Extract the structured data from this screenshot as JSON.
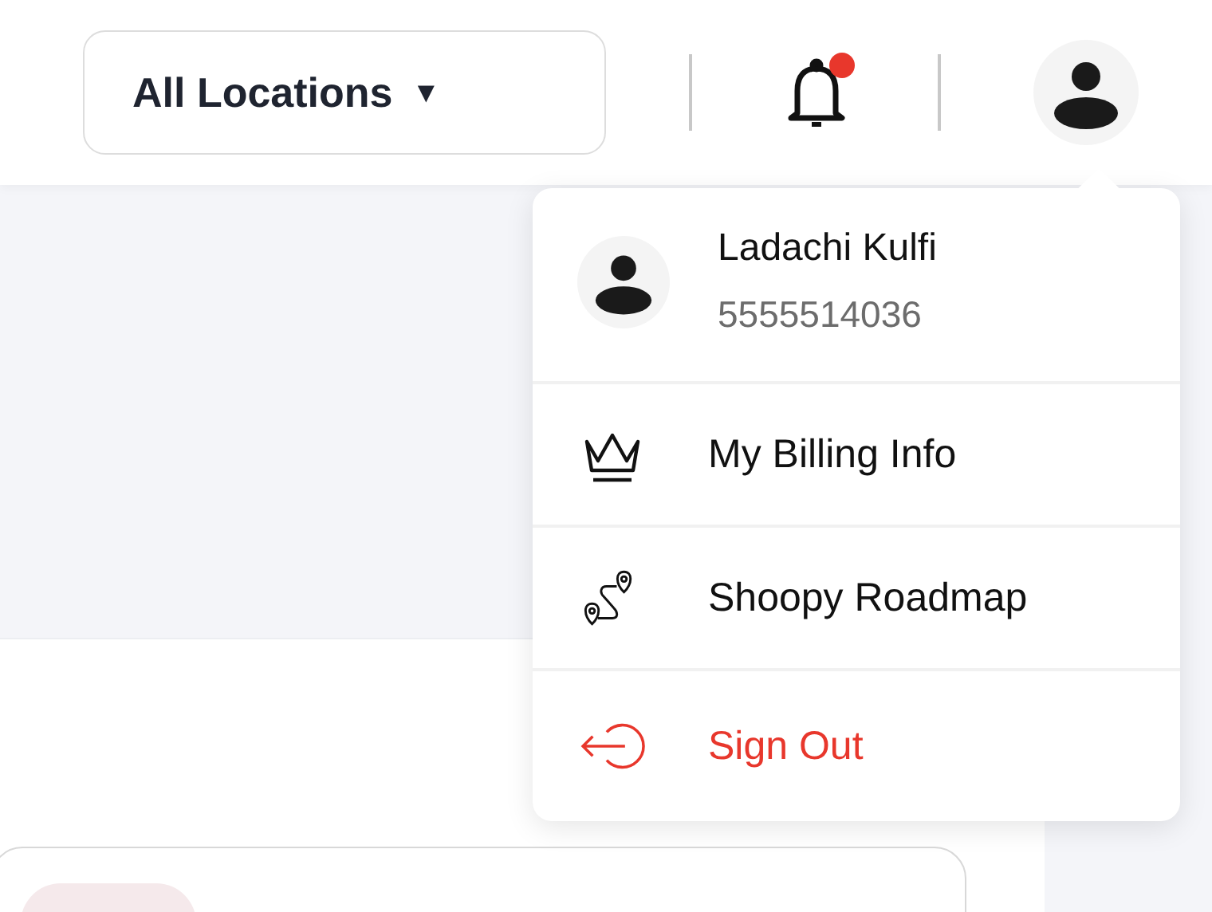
{
  "header": {
    "location_selector": {
      "label": "All Locations",
      "caret": "▼"
    },
    "notifications": {
      "unread": true
    }
  },
  "profile_menu": {
    "open": true,
    "user": {
      "name": "Ladachi Kulfi",
      "phone": "5555514036"
    },
    "items": [
      {
        "label": "My Billing Info",
        "kind": "billing"
      },
      {
        "label": "Shoopy Roadmap",
        "kind": "roadmap"
      },
      {
        "label": "Sign Out",
        "kind": "signout"
      }
    ]
  }
}
